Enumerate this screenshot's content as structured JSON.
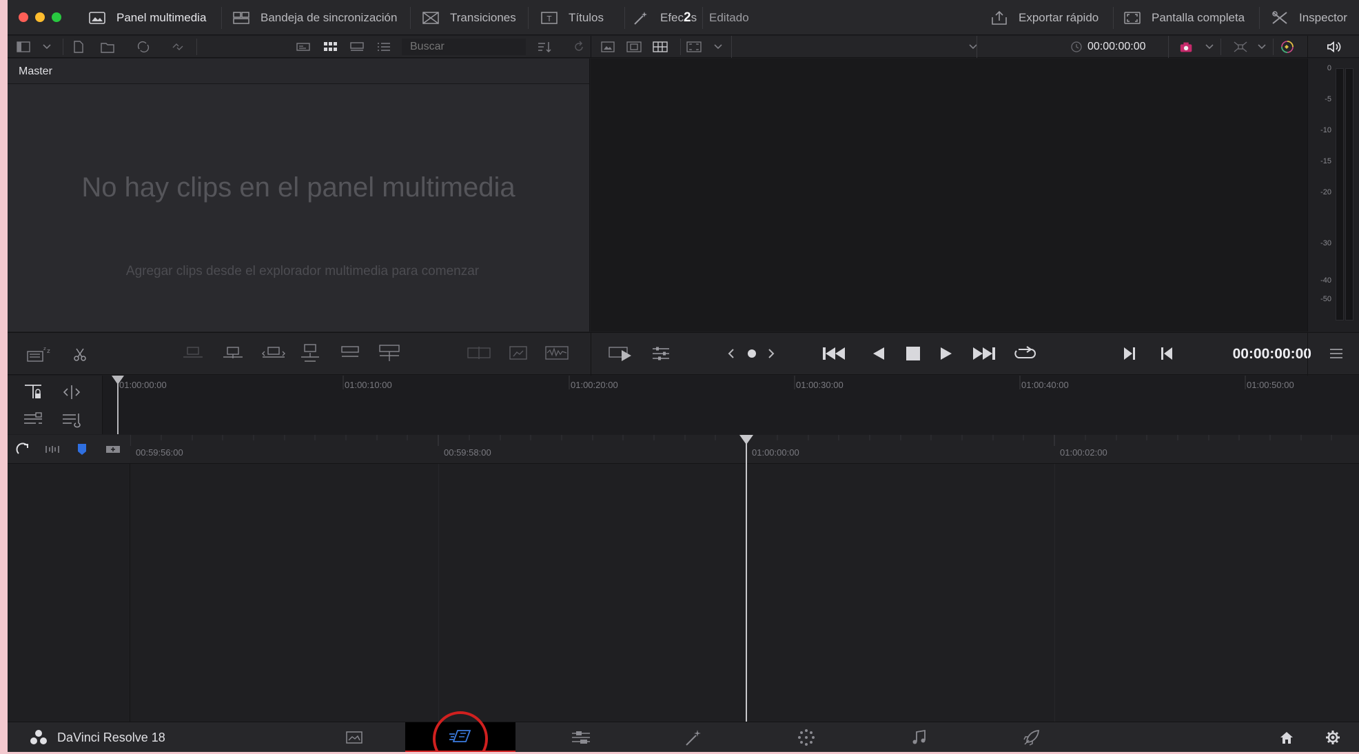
{
  "topbar": {
    "media_pool": "Panel multimedia",
    "sync_bin": "Bandeja de sincronización",
    "transitions": "Transiciones",
    "titles": "Títulos",
    "effects": "Efec",
    "effects_badge": "2",
    "effects_tail": "s",
    "edited": "Editado",
    "quick_export": "Exportar rápido",
    "fullscreen": "Pantalla completa",
    "inspector": "Inspector"
  },
  "toolbar": {
    "search_placeholder": "Buscar",
    "viewer_timecode": "00:00:00:00"
  },
  "media_pool": {
    "bin_name": "Master",
    "empty_title": "No hay clips en el panel multimedia",
    "empty_hint": "Agregar clips desde el explorador multimedia para comenzar"
  },
  "meter": {
    "labels": [
      "0",
      "-5",
      "-10",
      "-15",
      "-20",
      "-30",
      "-40",
      "-50"
    ]
  },
  "transport": {
    "timecode": "00:00:00:00"
  },
  "upper_ruler": {
    "ticks": [
      "01:00:00:00",
      "01:00:10:00",
      "01:00:20:00",
      "01:00:30:00",
      "01:00:40:00",
      "01:00:50:00"
    ]
  },
  "lower_ruler": {
    "ticks": [
      "00:59:56:00",
      "00:59:58:00",
      "01:00:00:00",
      "01:00:02:00"
    ]
  },
  "bottombar": {
    "app_name": "DaVinci Resolve 18"
  },
  "colors": {
    "accent_red": "#d0201f",
    "accent_blue": "#3b7be0",
    "bg": "#1d1d20"
  }
}
